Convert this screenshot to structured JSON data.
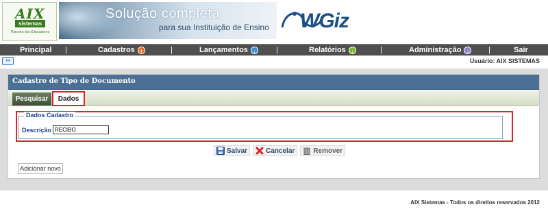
{
  "header": {
    "logo_main": "AIX",
    "logo_sistemas": "sistemas",
    "logo_tagline": "Parceira dos Educadores",
    "hero_line1": "Solução completa",
    "hero_line2": "para sua Instituição de Ensino",
    "brand_name": "WGiz"
  },
  "nav": {
    "items": [
      {
        "label": "Principal",
        "icon": "",
        "color": ""
      },
      {
        "label": "Cadastros",
        "icon": "plus-circle-icon",
        "color": "#e06b26"
      },
      {
        "label": "Lançamentos",
        "icon": "arrow-down-circle-icon",
        "color": "#3c8ad3"
      },
      {
        "label": "Relatórios",
        "icon": "arrow-down-circle-icon",
        "color": "#7bb32e"
      },
      {
        "label": "Administração",
        "icon": "arrow-down-circle-icon",
        "color": "#8a84c7"
      },
      {
        "label": "Sair",
        "icon": "",
        "color": ""
      }
    ],
    "separator": "|"
  },
  "toolbar": {
    "expand_icon": "expand-arrows-icon",
    "user_label": "Usuário: AIX SISTEMAS"
  },
  "panel": {
    "title": "Cadastro de Tipo de Documento",
    "tabs": [
      {
        "label": "Pesquisar",
        "active": false
      },
      {
        "label": "Dados",
        "active": true
      }
    ],
    "fieldset_legend": "Dados Cadastro",
    "description_label": "Descrição :",
    "description_value": "RECIBO",
    "actions": [
      {
        "label": "Salvar",
        "icon": "floppy-disk-icon",
        "enabled": true
      },
      {
        "label": "Cancelar",
        "icon": "red-x-icon",
        "enabled": true
      },
      {
        "label": "Remover",
        "icon": "trash-can-icon",
        "enabled": false
      }
    ],
    "add_button": "Adicionar novo"
  },
  "footer": {
    "text": "AIX Sistemas - Todos os direitos reservados 2012"
  },
  "colors": {
    "nav_bg": "#4f4f4f",
    "panel_title_bg": "#4b6f95",
    "highlight": "#d9242b",
    "main_bg": "#dcdcdc"
  }
}
